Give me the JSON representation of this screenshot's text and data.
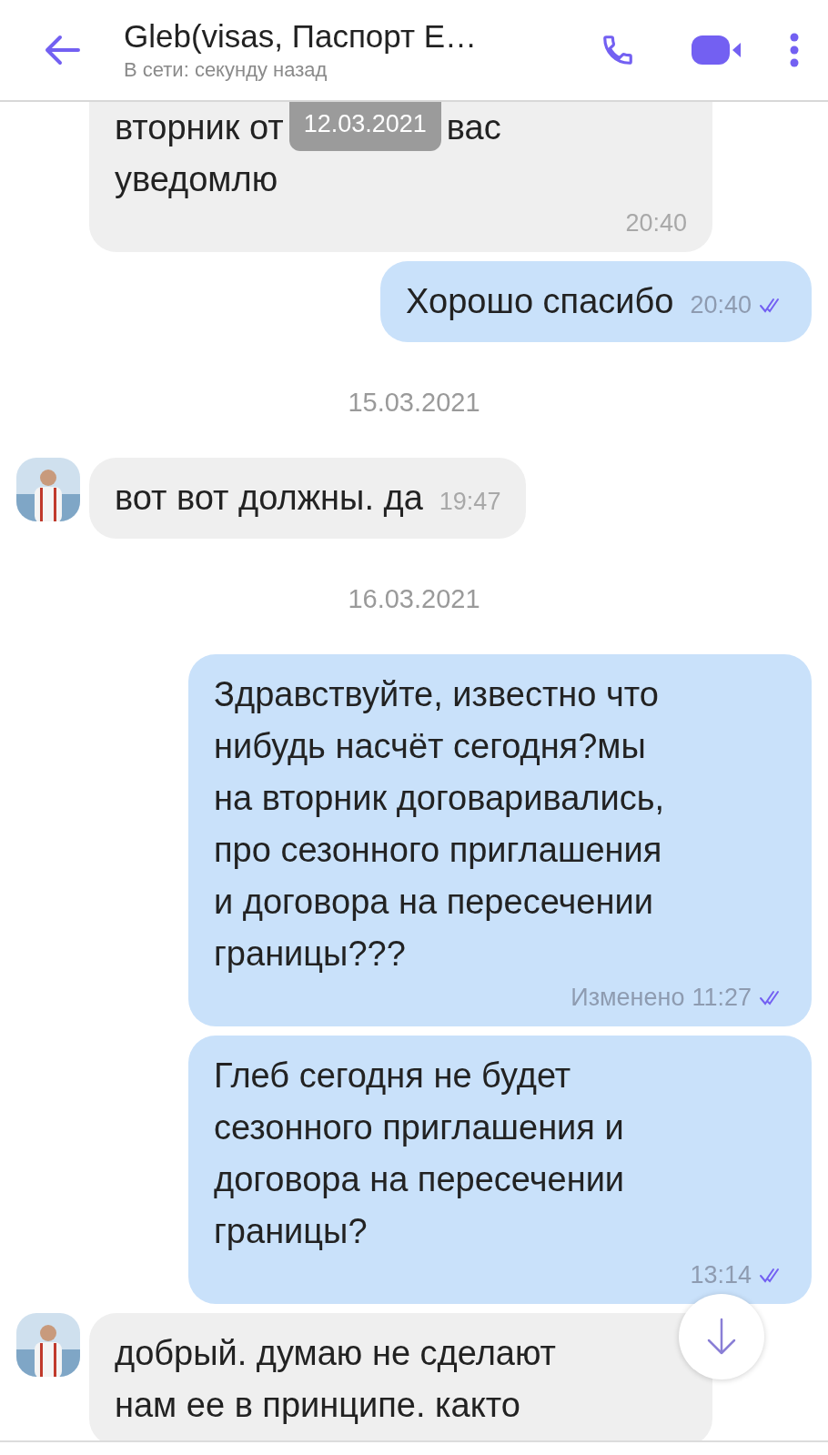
{
  "header": {
    "title": "Gleb(visas, Паспорт E…",
    "status": "В сети: секунду назад"
  },
  "floating_date": "12.03.2021",
  "messages": [
    {
      "kind": "received",
      "avatar": false,
      "covered_line": [
        "вторник от",
        "вас"
      ],
      "text": "уведомлю",
      "time": "20:40"
    },
    {
      "kind": "sent",
      "text": "Хорошо спасибо",
      "time": "20:40",
      "read": true
    },
    {
      "kind": "date",
      "text": "15.03.2021"
    },
    {
      "kind": "received",
      "avatar": true,
      "text": "вот вот должны. да",
      "time": "19:47"
    },
    {
      "kind": "date",
      "text": "16.03.2021"
    },
    {
      "kind": "sent",
      "text": "Здравствуйте, известно что\nнибудь насчёт сегодня?мы\nна вторник договаривались,\nпро сезонного приглашения\nи договора на пересечении\nграницы???",
      "edited": "Изменено",
      "time": "11:27",
      "read": true
    },
    {
      "kind": "sent",
      "text": "Глеб сегодня не будет\nсезонного приглашения и\nдоговора на пересечении\nграницы?",
      "time": "13:14",
      "read": true
    },
    {
      "kind": "received",
      "avatar": true,
      "text": "добрый. думаю не сделают\nнам ее в принципе. както"
    }
  ]
}
